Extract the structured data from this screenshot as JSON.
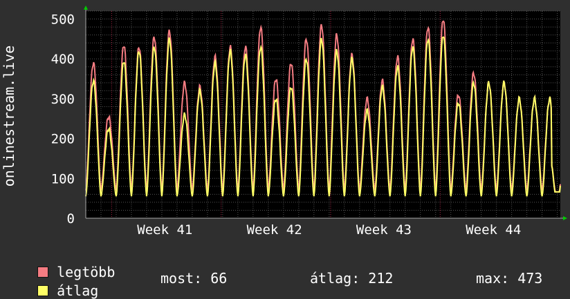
{
  "colors": {
    "background": "#2f2f2f",
    "plot_background": "#000000",
    "grid": "#555555",
    "week_line": "#aa2244",
    "max_series": "#f57c82",
    "avg_series": "#ffff66",
    "axis_arrow": "#00cc00"
  },
  "chart_data": {
    "type": "line",
    "ylabel": "onlinestream.live",
    "ylim": [
      0,
      520
    ],
    "yticks": [
      0,
      100,
      200,
      300,
      400,
      500
    ],
    "xrange_days": [
      0,
      31.2
    ],
    "week_ticks": [
      {
        "label": "Week 41",
        "day": 5.2
      },
      {
        "label": "Week 42",
        "day": 12.4
      },
      {
        "label": "Week 43",
        "day": 19.6
      },
      {
        "label": "Week 44",
        "day": 26.8
      }
    ],
    "daily_avg_peaks": [
      345,
      225,
      395,
      420,
      430,
      450,
      260,
      320,
      390,
      420,
      410,
      430,
      300,
      330,
      400,
      450,
      420,
      400,
      270,
      330,
      380,
      430,
      450,
      460,
      290,
      340,
      340,
      340,
      300,
      300,
      300,
      300
    ],
    "daily_max_peaks": [
      390,
      255,
      435,
      430,
      455,
      470,
      340,
      330,
      405,
      430,
      430,
      480,
      350,
      390,
      450,
      485,
      460,
      410,
      300,
      345,
      405,
      450,
      480,
      500,
      310,
      365,
      340,
      340,
      300,
      300,
      300,
      300
    ],
    "series": [
      {
        "name": "legtöbb",
        "color": "#f57c82",
        "kind": "max"
      },
      {
        "name": "átlag",
        "color": "#ffff66",
        "kind": "avg"
      }
    ],
    "grid": true
  },
  "legend": {
    "max_label": "legtöbb",
    "avg_label": "átlag"
  },
  "stats": {
    "current": "most: 66",
    "average": "átlag: 212",
    "maximum": "max: 473"
  }
}
